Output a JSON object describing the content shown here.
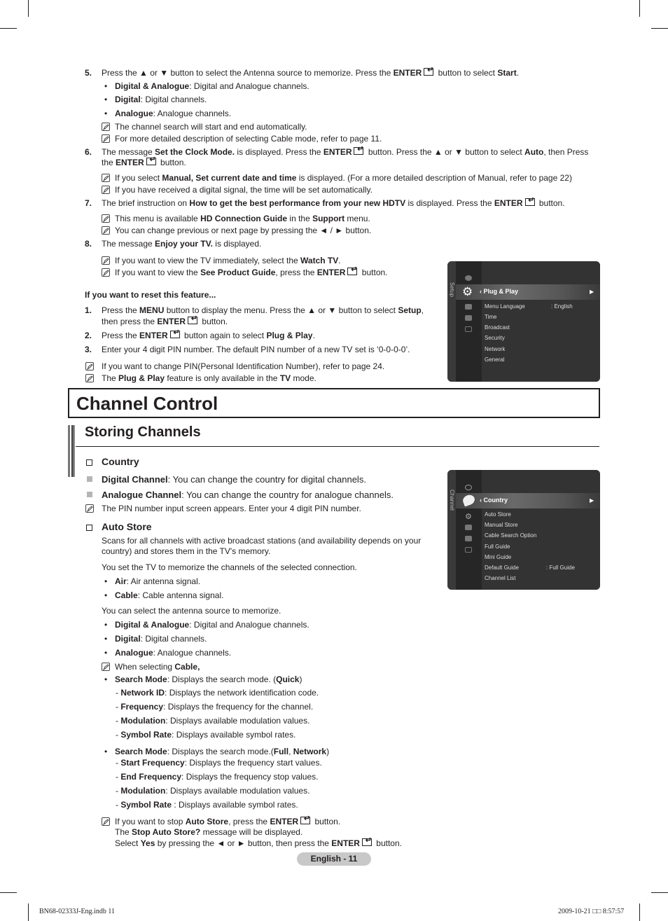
{
  "steps_top": {
    "s5": {
      "num": "5.",
      "a": "Press the ▲ or ▼ button to select the Antenna source to memorize. Press the ",
      "b": "ENTER",
      "c": " button to select ",
      "d": "Start",
      "e": "."
    },
    "s5_bullets": [
      {
        "bold": "Digital & Analogue",
        "text": ": Digital and Analogue channels."
      },
      {
        "bold": "Digital",
        "text": ": Digital channels."
      },
      {
        "bold": "Analogue",
        "text": ": Analogue channels."
      }
    ],
    "s5_notes": [
      "The channel search will start and end automatically.",
      "For more detailed description of selecting Cable mode, refer to page 11."
    ],
    "s6": {
      "num": "6.",
      "a": "The message ",
      "b": "Set the Clock Mode.",
      "c": " is displayed. Press the ",
      "d": "ENTER",
      "e": " button. Press the ▲ or ▼ button to select ",
      "f": "Auto",
      "g": ", then Press",
      "h": "the ",
      "i": "ENTER",
      "j": " button."
    },
    "s6_notes": [
      {
        "a": "If you select ",
        "b": "Manual, Set current date and time",
        "c": " is displayed. (For a more detailed description of Manual, refer to page 22)"
      },
      {
        "a": "If you have received a digital signal, the time will be set automatically.",
        "b": "",
        "c": ""
      }
    ],
    "s7": {
      "num": "7.",
      "a": "The brief instruction on ",
      "b": "How to get the best performance from your new HDTV",
      "c": " is displayed. Press the ",
      "d": "ENTER",
      "e": " button."
    },
    "s7_notes": [
      {
        "a": "This menu is available ",
        "b": "HD Connection Guide",
        "c": " in the ",
        "d": "Support",
        "e": " menu."
      },
      {
        "a": "You can change previous or next page by pressing the ◄ / ► button.",
        "b": "",
        "c": "",
        "d": "",
        "e": ""
      }
    ],
    "s8": {
      "num": "8.",
      "a": "The message ",
      "b": "Enjoy your TV.",
      "c": " is displayed."
    },
    "s8_notes": [
      {
        "a": "If you want to view the TV immediately, select the ",
        "b": "Watch TV",
        "c": "."
      },
      {
        "a": "If you want to view the ",
        "b": "See Product Guide",
        "c": ", press the ",
        "d": "ENTER",
        "e": " button."
      }
    ]
  },
  "reset": {
    "heading": "If you want to reset this feature...",
    "steps": [
      {
        "num": "1.",
        "a": "Press the ",
        "b": "MENU",
        "c": " button to display the menu. Press the ▲ or ▼ button to select ",
        "d": "Setup",
        "e": ",",
        "f": "then press the ",
        "g": "ENTER",
        "h": " button."
      },
      {
        "num": "2.",
        "a": "Press the ",
        "b": "ENTER",
        "c": " button again to select ",
        "d": "Plug & Play",
        "e": "."
      },
      {
        "num": "3.",
        "a": "Enter your 4 digit PIN number. The default PIN number of a new TV set is ‘0-0-0-0’."
      }
    ],
    "notes": [
      {
        "a": "If you want to change PIN(Personal Identification Number), refer to page 24."
      },
      {
        "a": "The ",
        "b": "Plug & Play",
        "c": " feature is only available in the ",
        "d": "TV",
        "e": " mode."
      }
    ]
  },
  "setup_menu": {
    "side_label": "Setup",
    "selected": "Plug & Play",
    "items": [
      "Menu Language",
      "Time",
      "Broadcast",
      "Security",
      "Network",
      "General"
    ],
    "menu_language_value": ": English"
  },
  "chapter_title": "Channel Control",
  "section_title": "Storing Channels",
  "country": {
    "title": "Country",
    "items": [
      {
        "bold": "Digital Channel",
        "text": ": You can change the country for digital channels."
      },
      {
        "bold": "Analogue Channel",
        "text": ": You can change the country for analogue channels."
      }
    ],
    "note": "The PIN number input screen appears. Enter your 4 digit PIN number."
  },
  "channel_menu": {
    "side_label": "Channel",
    "selected": "Country",
    "items": [
      "Auto Store",
      "Manual Store",
      "Cable Search Option",
      "Full Guide",
      "Mini Guide",
      "Default Guide",
      "Channel List"
    ],
    "default_guide_value": ": Full Guide"
  },
  "auto_store": {
    "title": "Auto Store",
    "desc1a": "Scans for all channels with active broadcast stations (and availability depends on your",
    "desc1b": "country) and stores them in the TV's memory.",
    "desc2": "You set the TV to memorize the channels of the selected connection.",
    "conn": [
      {
        "bold": "Air",
        "text": ": Air antenna signal."
      },
      {
        "bold": "Cable",
        "text": ": Cable antenna signal."
      }
    ],
    "desc3": "You can select the antenna source to memorize.",
    "sources": [
      {
        "bold": "Digital & Analogue",
        "text": ": Digital and Analogue channels."
      },
      {
        "bold": "Digital",
        "text": ": Digital channels."
      },
      {
        "bold": "Analogue",
        "text": ": Analogue channels."
      }
    ],
    "cable_note": {
      "a": "When selecting ",
      "b": "Cable,"
    },
    "quick": {
      "a": "Search Mode",
      "b": ": Displays the search mode. (",
      "c": "Quick",
      "d": ")"
    },
    "quick_sub": [
      {
        "bold": "Network ID",
        "text": ": Displays the network identification code."
      },
      {
        "bold": "Frequency",
        "text": ": Displays the frequency for the channel."
      },
      {
        "bold": "Modulation",
        "text": ": Displays available modulation values."
      },
      {
        "bold": "Symbol Rate",
        "text": ": Displays available symbol rates."
      }
    ],
    "full": {
      "a": "Search Mode",
      "b": ": Displays the search mode.(",
      "c": "Full",
      "d": ", ",
      "e": "Network",
      "f": ")"
    },
    "full_sub": [
      {
        "bold": "Start Frequency",
        "text": ": Displays the frequency start values."
      },
      {
        "bold": "End Frequency",
        "text": ": Displays the frequency stop values."
      },
      {
        "bold": "Modulation",
        "text": ": Displays available modulation values."
      },
      {
        "bold": "Symbol Rate",
        "text": " : Displays available symbol rates."
      }
    ],
    "stop_note": {
      "l1a": "If you want to stop ",
      "l1b": "Auto Store",
      "l1c": ", press the ",
      "l1d": "ENTER",
      "l1e": " button.",
      "l2a": "The ",
      "l2b": "Stop Auto Store?",
      "l2c": " message will be displayed.",
      "l3a": "Select ",
      "l3b": "Yes",
      "l3c": " by pressing the ◄ or ► button, then press the ",
      "l3d": "ENTER",
      "l3e": " button."
    }
  },
  "footer": {
    "page_label": "English - 11",
    "file": "BN68-02333J-Eng.indb   11",
    "date": "2009-10-21   □□ 8:57:57"
  }
}
